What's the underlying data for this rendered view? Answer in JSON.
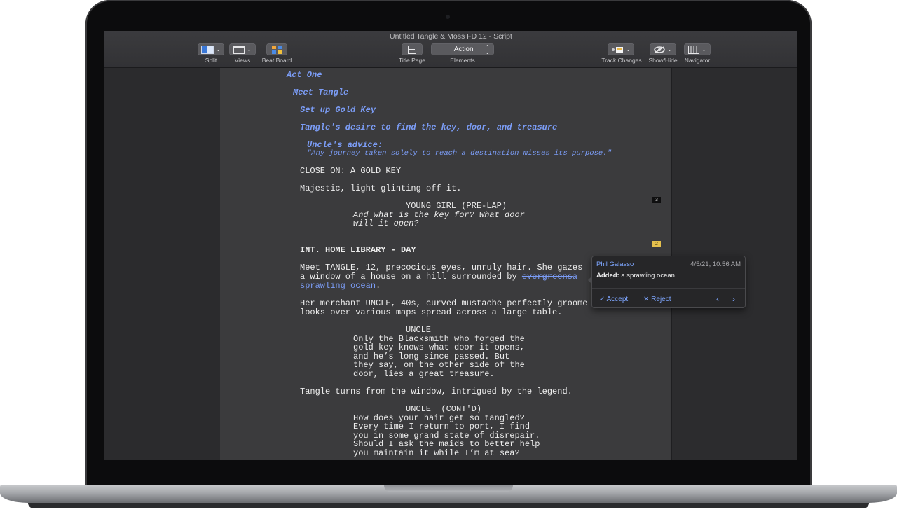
{
  "window": {
    "title": "Untitled Tangle & Moss FD 12 - Script"
  },
  "toolbar": {
    "split_label": "Split",
    "views_label": "Views",
    "beat_board_label": "Beat Board",
    "title_page_label": "Title Page",
    "elements_value": "Action",
    "elements_label": "Elements",
    "track_changes_label": "Track Changes",
    "show_hide_label": "Show/Hide",
    "navigator_label": "Navigator"
  },
  "script": {
    "act": "Act One",
    "sequence": "Meet Tangle",
    "scene": "Set up Gold Key",
    "beat": "Tangle's desire to find the key, door, and treasure",
    "note_title": "Uncle's advice:",
    "note_body": "\"Any journey taken solely to reach a destination misses its purpose.\"",
    "action1": "CLOSE ON: A GOLD KEY",
    "action2": "Majestic, light glinting off it.",
    "char1": "YOUNG GIRL (PRE-LAP)",
    "dialog1": [
      "And what is the key for? What door",
      "will it open?"
    ],
    "scene_heading": "INT. HOME LIBRARY - DAY",
    "action3_line1": "Meet TANGLE, 12, precocious eyes, unruly hair. She gazes",
    "action3_line2a": "a window of a house on a hill surrounded by ",
    "action3_struck": "evergreens",
    "action3_added1": "a",
    "action3_added2": "sprawling ocean",
    "action3_end": ".",
    "action4": [
      "Her merchant UNCLE, 40s, curved mustache perfectly groome",
      "looks over various maps spread across a large table."
    ],
    "char2": "UNCLE",
    "dialog2": [
      "Only the Blacksmith who forged the",
      "gold key knows what door it opens,",
      "and he’s long since passed. But",
      "they say, on the other side of the",
      "door, lies a great treasure."
    ],
    "action5": "Tangle turns from the window, intrigued by the legend.",
    "char3": "UNCLE  (CONT'D)",
    "dialog3": [
      "How does your hair get so tangled?",
      "Every time I return to port, I find",
      "you in some grand state of disrepair.",
      "Should I ask the maids to better help",
      "you maintain it while I’m at sea?"
    ]
  },
  "markers": {
    "first": "3",
    "second": "2"
  },
  "change_popover": {
    "author": "Phil Galasso",
    "date": "4/5/21, 10:56 AM",
    "added_label": "Added:",
    "added_text": "a sprawling ocean",
    "accept_label": "Accept",
    "reject_label": "Reject"
  },
  "colors": {
    "outline_blue": "#7b9cf5",
    "page_bg": "#3b3b3d",
    "marker_yellow": "#e6c14d"
  }
}
